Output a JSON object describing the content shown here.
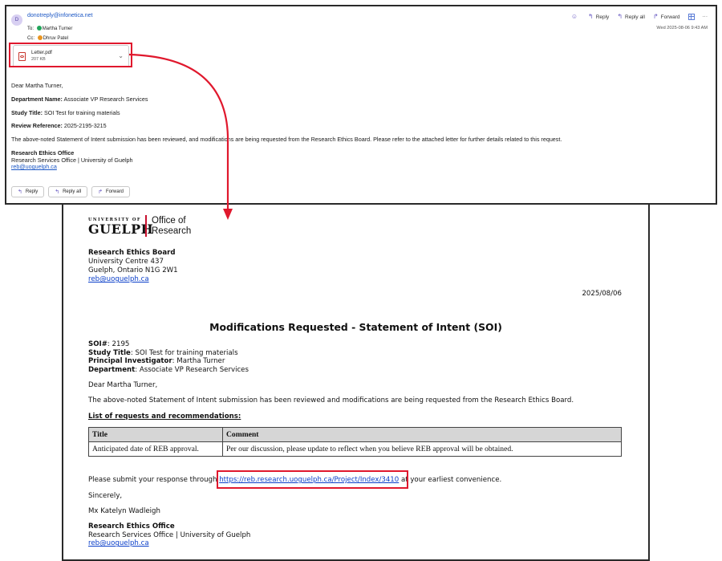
{
  "email": {
    "avatar_initial": "D",
    "sender": "donotreply@infonetica.net",
    "to_label": "To:",
    "to_name": "Martha Turner",
    "cc_label": "Cc:",
    "cc_name": "Dhruv Patel",
    "timestamp": "Wed 2025-08-06 9:43 AM",
    "actions": {
      "emoji_icon": "smiley-icon",
      "reply": "Reply",
      "reply_all": "Reply all",
      "forward": "Forward",
      "more": "···"
    },
    "attachment": {
      "name": "Letter.pdf",
      "size": "207 KB"
    },
    "body": {
      "greeting": "Dear Martha Turner,",
      "dept_label": "Department Name:",
      "dept_value": "Associate VP Research Services",
      "study_label": "Study Title:",
      "study_value": "SOI Test for training materials",
      "ref_label": "Review Reference:",
      "ref_value": "2025-2195-3215",
      "message": "The above-noted Statement of Intent submission has been reviewed, and modifications are being requested from the Research Ethics Board. Please refer to the attached letter for further details related to this request.",
      "sig_name": "Research Ethics Office",
      "sig_org": "Research Services Office | University of Guelph",
      "sig_email": "reb@uoguelph.ca"
    },
    "reply_buttons": {
      "reply": "Reply",
      "reply_all": "Reply all",
      "forward": "Forward"
    }
  },
  "letter": {
    "logo": {
      "university_of": "UNIVERSITY OF",
      "guelph": "GUELPH",
      "office_line1": "Office of",
      "office_line2": "Research"
    },
    "board": {
      "name": "Research Ethics Board",
      "line1": "University Centre 437",
      "line2": "Guelph, Ontario N1G 2W1",
      "email": "reb@uoguelph.ca"
    },
    "date": "2025/08/06",
    "title": "Modifications Requested - Statement of Intent (SOI)",
    "soi": {
      "soi_label": "SOI#",
      "soi_value": ": 2195",
      "study_label": "Study Title",
      "study_value": ": SOI Test for training materials",
      "pi_label": "Principal Investigator",
      "pi_value": ":  Martha Turner",
      "dept_label": "Department",
      "dept_value": ": Associate VP Research Services"
    },
    "greeting": "Dear Martha Turner,",
    "paragraph": "The above-noted Statement of Intent submission has been reviewed and modifications are being requested from the Research Ethics Board.",
    "list_heading": "List of requests and recommendations:",
    "table": {
      "headers": [
        "Title",
        "Comment"
      ],
      "rows": [
        [
          "Anticipated date of REB approval.",
          "Per our discussion, please update to reflect when you believe REB approval will be obtained."
        ]
      ]
    },
    "submit_before": "Please submit your response through ",
    "submit_url": "https://reb.research.uoguelph.ca/Project/Index/3410",
    "submit_after": " at your earliest convenience.",
    "sincerely": "Sincerely,",
    "signer": "Mx Katelyn Wadleigh",
    "office_name": "Research Ethics Office",
    "office_org": "Research Services Office | University of Guelph",
    "office_email": "reb@uoguelph.ca"
  },
  "colors": {
    "highlight": "#e0182d",
    "link": "#0b3fc9",
    "accent": "#6d5fc4"
  }
}
